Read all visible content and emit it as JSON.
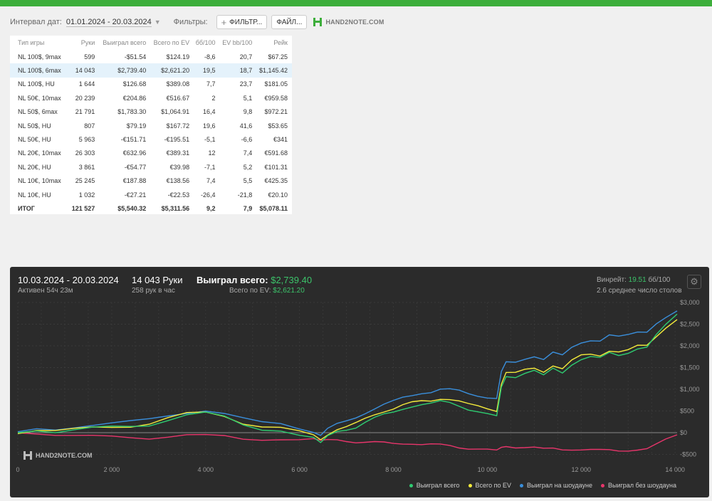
{
  "filter": {
    "date_label": "Интервал дат:",
    "date_value": "01.01.2024 - 20.03.2024",
    "filters_label": "Фильтры:",
    "filter_button": "ФИЛЬТР...",
    "file_button": "ФАЙЛ...",
    "logo_text": "HAND2NOTE.COM"
  },
  "table": {
    "headers": [
      "Тип игры",
      "Руки",
      "Выиграл всего",
      "Всего по EV",
      "бб/100",
      "EV bb/100",
      "Рейк"
    ],
    "rows": [
      {
        "c": [
          "NL 100$, 9max",
          "599",
          "-$51.54",
          "$124.19",
          "-8,6",
          "20,7",
          "$67.25"
        ],
        "s": [
          "",
          "",
          "neg",
          "pos",
          "neg",
          "pos",
          "pos"
        ]
      },
      {
        "c": [
          "NL 100$, 6max",
          "14 043",
          "$2,739.40",
          "$2,621.20",
          "19,5",
          "18,7",
          "$1,145.42"
        ],
        "s": [
          "",
          "",
          "pos",
          "pos",
          "pos",
          "pos",
          "pos"
        ],
        "selected": true
      },
      {
        "c": [
          "NL 100$, HU",
          "1 644",
          "$126.68",
          "$389.08",
          "7,7",
          "23,7",
          "$181.05"
        ],
        "s": [
          "",
          "",
          "pos",
          "pos",
          "pos",
          "pos",
          "pos"
        ]
      },
      {
        "c": [
          "NL 50€, 10max",
          "20 239",
          "€204.86",
          "€516.67",
          "2",
          "5,1",
          "€959.58"
        ],
        "s": [
          "",
          "",
          "pos",
          "pos",
          "pos",
          "pos",
          "pos"
        ]
      },
      {
        "c": [
          "NL 50$, 6max",
          "21 791",
          "$1,783.30",
          "$1,064.91",
          "16,4",
          "9,8",
          "$972.21"
        ],
        "s": [
          "",
          "",
          "pos",
          "pos",
          "pos",
          "pos",
          "pos"
        ]
      },
      {
        "c": [
          "NL 50$, HU",
          "807",
          "$79.19",
          "$167.72",
          "19,6",
          "41,6",
          "$53.65"
        ],
        "s": [
          "",
          "",
          "pos",
          "pos",
          "pos",
          "pos",
          "pos"
        ]
      },
      {
        "c": [
          "NL 50€, HU",
          "5 963",
          "-€151.71",
          "-€195.51",
          "-5,1",
          "-6,6",
          "€341"
        ],
        "s": [
          "",
          "",
          "neg",
          "neg",
          "neg",
          "neg",
          "pos"
        ]
      },
      {
        "c": [
          "NL 20€, 10max",
          "26 303",
          "€632.96",
          "€389.31",
          "12",
          "7,4",
          "€591.68"
        ],
        "s": [
          "",
          "",
          "pos",
          "pos",
          "pos",
          "pos",
          "pos"
        ]
      },
      {
        "c": [
          "NL 20€, HU",
          "3 861",
          "-€54.77",
          "€39.98",
          "-7,1",
          "5,2",
          "€101.31"
        ],
        "s": [
          "",
          "",
          "neg",
          "pos",
          "neg",
          "pos",
          "pos"
        ]
      },
      {
        "c": [
          "NL 10€, 10max",
          "25 245",
          "€187.88",
          "€138.56",
          "7,4",
          "5,5",
          "€425.35"
        ],
        "s": [
          "",
          "",
          "pos",
          "pos",
          "pos",
          "pos",
          "pos"
        ]
      },
      {
        "c": [
          "NL 10€, HU",
          "1 032",
          "-€27.21",
          "-€22.53",
          "-26,4",
          "-21,8",
          "€20.10"
        ],
        "s": [
          "",
          "",
          "neg",
          "neg",
          "neg",
          "neg",
          "pos"
        ]
      }
    ],
    "total": {
      "c": [
        "ИТОГ",
        "121 527",
        "$5,540.32",
        "$5,311.56",
        "9,2",
        "7,9",
        "$5,078.11"
      ],
      "s": [
        "",
        "",
        "pos",
        "pos",
        "pos",
        "pos",
        "pos"
      ]
    }
  },
  "panel": {
    "date_range": "10.03.2024 - 20.03.2024",
    "active": "Активен 54ч 23м",
    "hands": "14 043 Руки",
    "hands_per_hour": "258 рук в час",
    "won_label": "Выиграл всего:",
    "won_value": "$2,739.40",
    "ev_label": "Всего по EV:",
    "ev_value": "$2,621.20",
    "winrate_label": "Винрейт:",
    "winrate_value": "19.51",
    "winrate_unit": "бб/100",
    "tables": "2.6 среднее число столов",
    "watermark": "HAND2NOTE.COM"
  },
  "colors": {
    "won": "#2ecc71",
    "ev": "#f5ec3b",
    "sd": "#3a8fdc",
    "nsd": "#e8356b"
  },
  "chart_data": {
    "type": "line",
    "xlabel": "",
    "ylabel": "",
    "xlim": [
      0,
      14043
    ],
    "ylim": [
      -650,
      3000
    ],
    "x_ticks": [
      "0",
      "2 000",
      "4 000",
      "6 000",
      "8 000",
      "10 000",
      "12 000",
      "14 000"
    ],
    "y_ticks": [
      "$3,000",
      "$2,500",
      "$2,000",
      "$1,500",
      "$1,000",
      "$500",
      "$0",
      "-$500"
    ],
    "x": [
      0,
      400,
      800,
      1200,
      1600,
      2000,
      2400,
      2800,
      3200,
      3600,
      4000,
      4400,
      4800,
      5200,
      5600,
      6000,
      6300,
      6450,
      6600,
      6800,
      7000,
      7200,
      7400,
      7600,
      7800,
      8000,
      8200,
      8400,
      8600,
      8800,
      9000,
      9200,
      9400,
      9600,
      9800,
      10000,
      10200,
      10300,
      10400,
      10600,
      10800,
      11000,
      11200,
      11400,
      11600,
      11800,
      12000,
      12200,
      12400,
      12600,
      12800,
      13000,
      13200,
      13400,
      13600,
      13800,
      14043
    ],
    "series": [
      {
        "name": "Выиграл всего",
        "values": [
          0,
          60,
          20,
          70,
          110,
          130,
          140,
          170,
          300,
          420,
          460,
          360,
          170,
          70,
          60,
          -50,
          -120,
          -250,
          -80,
          40,
          80,
          120,
          230,
          330,
          420,
          480,
          560,
          610,
          640,
          660,
          720,
          700,
          630,
          540,
          480,
          420,
          370,
          1050,
          1310,
          1290,
          1370,
          1420,
          1310,
          1480,
          1390,
          1580,
          1690,
          1740,
          1710,
          1840,
          1790,
          1850,
          1940,
          1960,
          2240,
          2480,
          2740
        ]
      },
      {
        "name": "Всего по EV",
        "values": [
          0,
          50,
          30,
          80,
          130,
          140,
          150,
          200,
          330,
          440,
          470,
          390,
          220,
          140,
          110,
          20,
          -60,
          -150,
          -30,
          80,
          130,
          210,
          320,
          420,
          500,
          560,
          640,
          690,
          720,
          730,
          790,
          780,
          730,
          650,
          600,
          550,
          510,
          1140,
          1390,
          1370,
          1440,
          1480,
          1410,
          1560,
          1480,
          1660,
          1770,
          1800,
          1780,
          1900,
          1870,
          1900,
          1990,
          2000,
          2220,
          2430,
          2620
        ]
      },
      {
        "name": "Выиграл на шоудауне",
        "values": [
          0,
          70,
          60,
          130,
          190,
          230,
          260,
          300,
          380,
          460,
          520,
          450,
          330,
          230,
          200,
          100,
          30,
          -50,
          90,
          190,
          260,
          350,
          460,
          560,
          650,
          720,
          800,
          860,
          920,
          940,
          1000,
          990,
          960,
          900,
          860,
          820,
          790,
          1390,
          1610,
          1620,
          1710,
          1770,
          1690,
          1840,
          1770,
          1960,
          2080,
          2140,
          2120,
          2240,
          2200,
          2250,
          2330,
          2340,
          2520,
          2640,
          2780
        ]
      },
      {
        "name": "Выиграл без шоудауна",
        "values": [
          0,
          -10,
          -40,
          -60,
          -80,
          -100,
          -120,
          -130,
          -80,
          -40,
          -60,
          -90,
          -160,
          -160,
          -140,
          -150,
          -150,
          -200,
          -170,
          -150,
          -180,
          -220,
          -230,
          -230,
          -230,
          -240,
          -240,
          -250,
          -280,
          -280,
          -280,
          -290,
          -330,
          -360,
          -380,
          -400,
          -420,
          -340,
          -300,
          -330,
          -340,
          -350,
          -380,
          -360,
          -380,
          -380,
          -390,
          -400,
          -410,
          -400,
          -410,
          -400,
          -390,
          -380,
          -280,
          -160,
          -40
        ]
      }
    ]
  }
}
